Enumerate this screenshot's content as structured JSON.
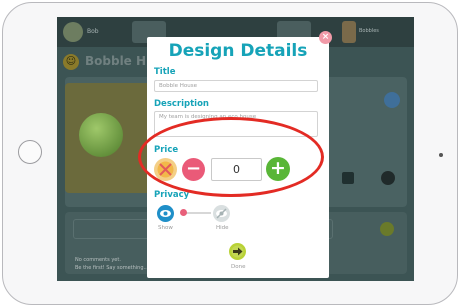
{
  "background_app": {
    "topbar_label": "Bob",
    "user_label": "Bobbles",
    "page_title": "Bobble H",
    "comment_line1": "No comments yet.",
    "comment_line2": "Be the first! Say something..."
  },
  "modal": {
    "title": "Design Details",
    "title_label": "Title",
    "title_value": "Bobble House",
    "description_label": "Description",
    "description_value": "My team is designing an eco house",
    "price_label": "Price",
    "price_value": "0",
    "privacy_label": "Privacy",
    "show_label": "Show",
    "hide_label": "Hide",
    "done_label": "Done",
    "close_glyph": "×",
    "minus_glyph": "−",
    "plus_glyph": "+"
  },
  "colors": {
    "accent": "#16a3b8",
    "minus": "#ea5a78",
    "plus": "#59b637",
    "annotation": "#e32b24"
  },
  "icons": [
    "close-icon",
    "coin-disabled-icon",
    "minus-icon",
    "plus-icon",
    "eye-show-icon",
    "eye-hidden-icon",
    "done-arrow-icon"
  ]
}
